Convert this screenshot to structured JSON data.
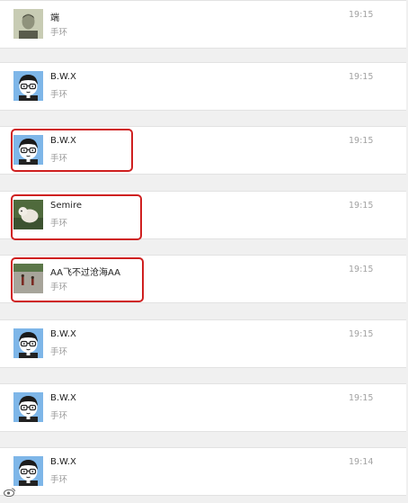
{
  "conversations": [
    {
      "name": "端",
      "subtitle": "手环",
      "time": "19:15",
      "avatar": "photo-portrait-avatar",
      "highlighted": false
    },
    {
      "name": "B.W.X",
      "subtitle": "手环",
      "time": "19:15",
      "avatar": "cartoon-boy-avatar",
      "highlighted": false
    },
    {
      "name": "B.W.X",
      "subtitle": "手环",
      "time": "19:15",
      "avatar": "cartoon-boy-avatar",
      "highlighted": true
    },
    {
      "name": "Semire",
      "subtitle": "手环",
      "time": "19:15",
      "avatar": "dog-photo-avatar",
      "highlighted": true
    },
    {
      "name": "AA飞不过沧海AA",
      "subtitle": "手环",
      "time": "19:15",
      "avatar": "outdoor-photo-avatar",
      "highlighted": true
    },
    {
      "name": "B.W.X",
      "subtitle": "手环",
      "time": "19:15",
      "avatar": "cartoon-boy-avatar",
      "highlighted": false
    },
    {
      "name": "B.W.X",
      "subtitle": "手环",
      "time": "19:15",
      "avatar": "cartoon-boy-avatar",
      "highlighted": false
    },
    {
      "name": "B.W.X",
      "subtitle": "手环",
      "time": "19:14",
      "avatar": "cartoon-boy-avatar",
      "highlighted": false
    }
  ],
  "watermark": {
    "icon": "weibo-logo-icon"
  },
  "colors": {
    "highlight_border": "#cf2020",
    "avatar_bg": "#7eb6e8",
    "page_bg": "#f0f0f0"
  }
}
